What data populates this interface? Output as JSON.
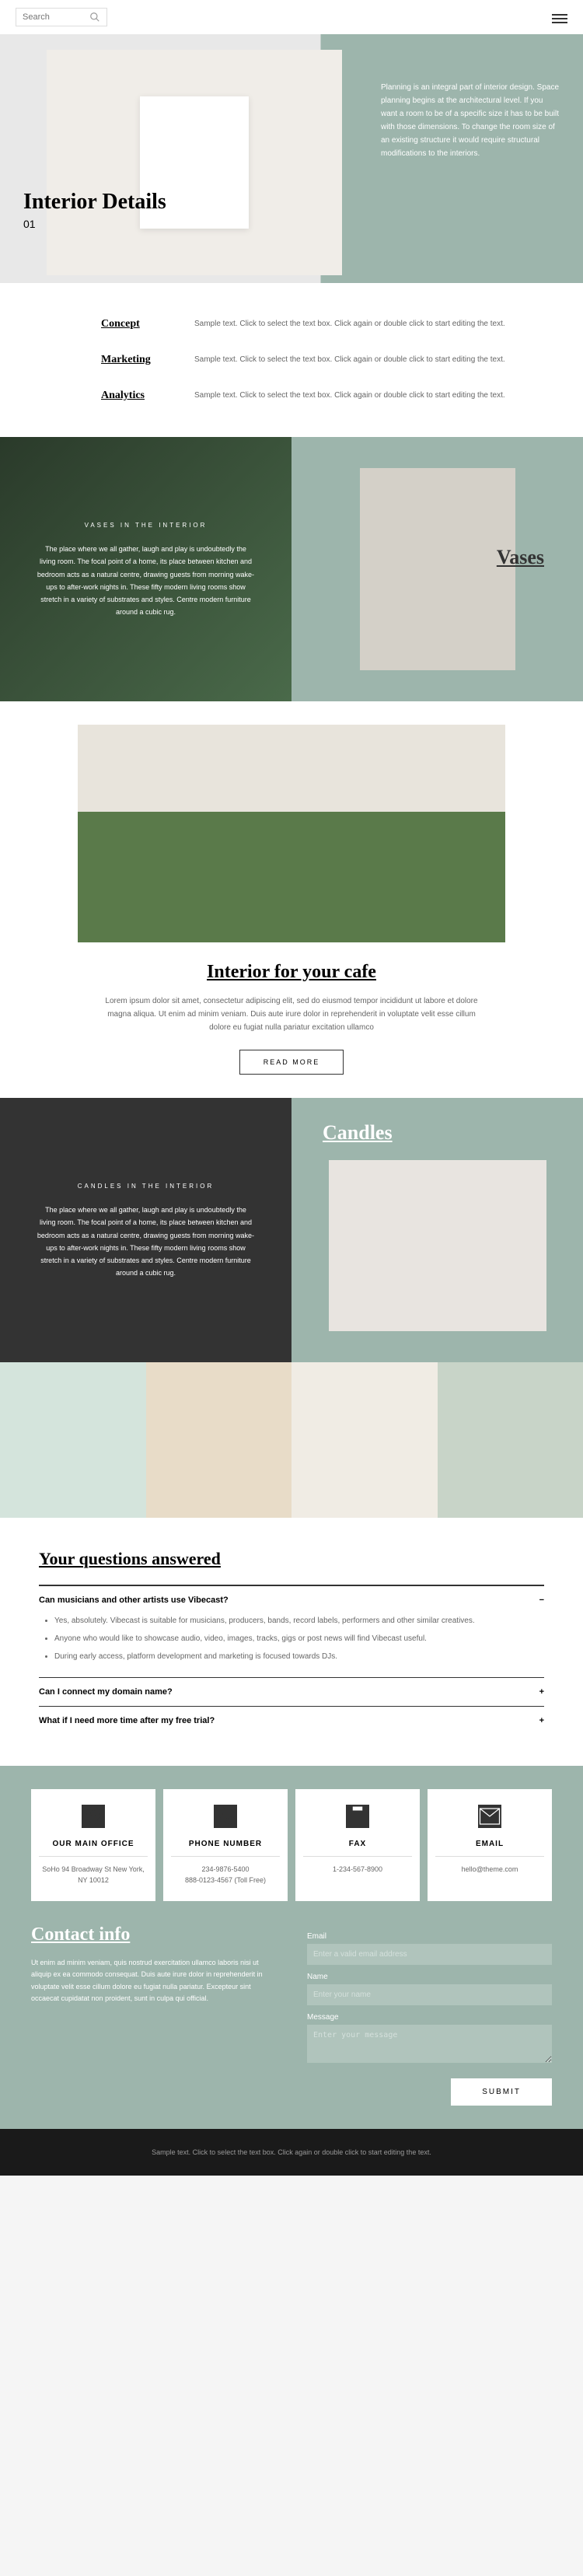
{
  "header": {
    "search_placeholder": "Search"
  },
  "hero": {
    "title": "Interior Details",
    "num": "01",
    "text": "Planning is an integral part of interior design. Space planning begins at the architectural level. If you want a room to be of a specific size it has to be built with those dimensions. To change the room size of an existing structure it would require structural modifications to the interiors."
  },
  "concepts": [
    {
      "title": "Concept",
      "text": "Sample text. Click to select the text box. Click again or double click to start editing the text."
    },
    {
      "title": "Marketing",
      "text": "Sample text. Click to select the text box. Click again or double click to start editing the text."
    },
    {
      "title": "Analytics",
      "text": "Sample text. Click to select the text box. Click again or double click to start editing the text."
    }
  ],
  "vases": {
    "label": "VASES IN THE INTERIOR",
    "text": "The place where we all gather, laugh and play is undoubtedly the living room. The focal point of a home, its place between kitchen and bedroom acts as a natural centre, drawing guests from morning wake-ups to after-work nights in. These fifty modern living rooms show stretch in a variety of substrates and styles. Centre modern furniture around a cubic rug.",
    "title": "Vases"
  },
  "cafe": {
    "title": "Interior for your cafe",
    "text": "Lorem ipsum dolor sit amet, consectetur adipiscing elit, sed do eiusmod tempor incididunt ut labore et dolore magna aliqua. Ut enim ad minim veniam. Duis aute irure dolor in reprehenderit in voluptate velit esse cillum dolore eu fugiat nulla pariatur excitation ullamco",
    "button": "READ MORE"
  },
  "candles": {
    "label": "CANDLES IN THE INTERIOR",
    "text": "The place where we all gather, laugh and play is undoubtedly the living room. The focal point of a home, its place between kitchen and bedroom acts as a natural centre, drawing guests from morning wake-ups to after-work nights in. These fifty modern living rooms show stretch in a variety of substrates and styles. Centre modern furniture around a cubic rug.",
    "title": "Candles"
  },
  "faq": {
    "title": "Your questions answered",
    "items": [
      {
        "q": "Can musicians and other artists use Vibecast?",
        "a": [
          "Yes, absolutely. Vibecast is suitable for musicians, producers, bands, record labels, performers and other similar creatives.",
          "Anyone who would like to showcase audio, video, images, tracks, gigs or post news will find Vibecast useful.",
          "During early access, platform development and marketing is focused towards DJs."
        ]
      },
      {
        "q": "Can I connect my domain name?"
      },
      {
        "q": "What if I need more time after my free trial?"
      }
    ]
  },
  "contact": {
    "cards": [
      {
        "title": "OUR MAIN OFFICE",
        "text": "SoHo 94 Broadway St New York, NY 10012"
      },
      {
        "title": "PHONE NUMBER",
        "text": "234-9876-5400\n888-0123-4567 (Toll Free)"
      },
      {
        "title": "FAX",
        "text": "1-234-567-8900"
      },
      {
        "title": "EMAIL",
        "text": "hello@theme.com"
      }
    ],
    "title": "Contact info",
    "text": "Ut enim ad minim veniam, quis nostrud exercitation ullamco laboris nisi ut aliquip ex ea commodo consequat. Duis aute irure dolor in reprehenderit in voluptate velit esse cillum dolore eu fugiat nulla pariatur. Excepteur sint occaecat cupidatat non proident, sunt in culpa qui official.",
    "form": {
      "email_label": "Email",
      "email_ph": "Enter a valid email address",
      "name_label": "Name",
      "name_ph": "Enter your name",
      "msg_label": "Message",
      "msg_ph": "Enter your message",
      "submit": "SUBMIT"
    }
  },
  "footer": "Sample text. Click to select the text box. Click again or double click to start editing the text."
}
